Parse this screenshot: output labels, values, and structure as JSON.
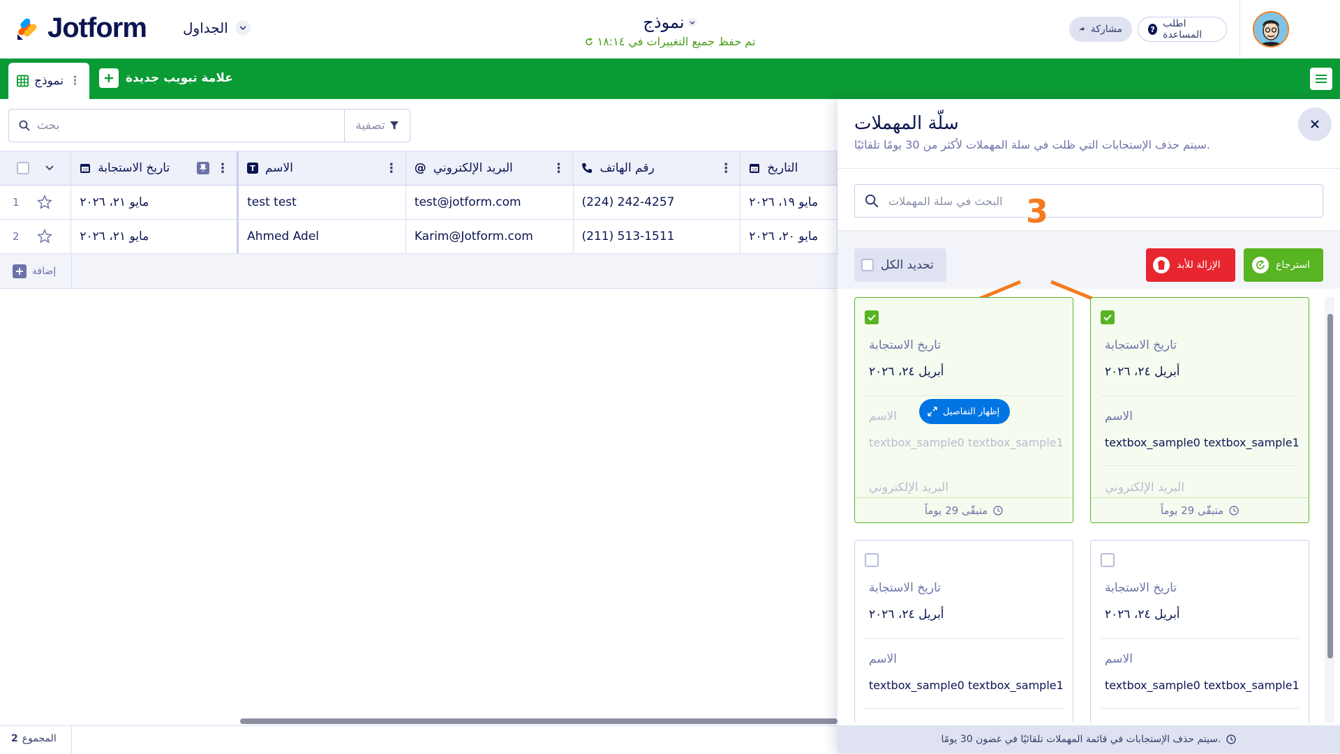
{
  "header": {
    "logo_text": "Jotform",
    "nav_label": "الجداول",
    "form_title": "نموذج",
    "save_status": "تم حفظ جميع التغييرات في ١٨:١٤",
    "share_label": "مشاركة",
    "help_label": "اطلب المساعدة"
  },
  "tabbar": {
    "active_tab": "نموذج",
    "add_tab_label": "علامة تبويب جديدة"
  },
  "toolbar": {
    "search_placeholder": "بحث",
    "filter_label": "تصفية"
  },
  "table": {
    "columns": [
      "تاريخ الاستجابة",
      "الاسم",
      "البريد الإلكتروني",
      "رقم الهاتف",
      "التاريخ"
    ],
    "rows": [
      {
        "num": "1",
        "resp": "مايو ٢١، ٢٠٢٦",
        "name": "test test",
        "email": "test@jotform.com",
        "phone": "(224) 242-4257",
        "date": "مايو ١٩، ٢٠٢٦"
      },
      {
        "num": "2",
        "resp": "مايو ٢١، ٢٠٢٦",
        "name": "Ahmed Adel",
        "email": "Karim@Jotform.com",
        "phone": "(211) 513-1511",
        "date": "مايو ٢٠، ٢٠٢٦"
      }
    ],
    "add_label": "إضافة",
    "total_label": "المجموع",
    "total_value": "2"
  },
  "trash": {
    "title": "سلّة المهملات",
    "subtitle": "سيتم حذف الإستجابات التي ظلت في سلة المهملات لأكثر من 30 يومًا تلقائيًا.",
    "search_placeholder": "البحث في سلة المهملات",
    "select_all_label": "تحديد الكل",
    "delete_label": "الإزالة للأبد",
    "restore_label": "استرجاع",
    "step_number": "3",
    "show_details_label": "إظهار التفاصيل",
    "footer_note": "سيتم حذف الإستجابات في قائمة المهملات تلقائيًا في غضون 30 يومًا.",
    "cards": [
      {
        "selected": true,
        "label_date": "تاريخ الاستجابة",
        "date": "أبريل ٢٤، ٢٠٢٦",
        "label_name": "الاسم",
        "name": "textbox_sample0 textbox_sample1",
        "label_email": "البريد الإلكتروني",
        "remaining": "متبقّى 29 يوماً"
      },
      {
        "selected": true,
        "label_date": "تاريخ الاستجابة",
        "date": "أبريل ٢٤، ٢٠٢٦",
        "label_name": "الاسم",
        "name": "textbox_sample0 textbox_sample1",
        "label_email": "البريد الإلكتروني",
        "remaining": "متبقّى 29 يوماً"
      },
      {
        "selected": false,
        "label_date": "تاريخ الاستجابة",
        "date": "أبريل ٢٤، ٢٠٢٦",
        "label_name": "الاسم",
        "name": "textbox_sample0 textbox_sample1"
      },
      {
        "selected": false,
        "label_date": "تاريخ الاستجابة",
        "date": "أبريل ٢٤، ٢٠٢٦",
        "label_name": "الاسم",
        "name": "textbox_sample0 textbox_sample1"
      }
    ]
  },
  "colors": {
    "brand_green": "#0a9b35",
    "delete_red": "#e7262f",
    "restore_green": "#58b422",
    "annotation_orange": "#f47b20",
    "info_blue": "#0075e3"
  }
}
